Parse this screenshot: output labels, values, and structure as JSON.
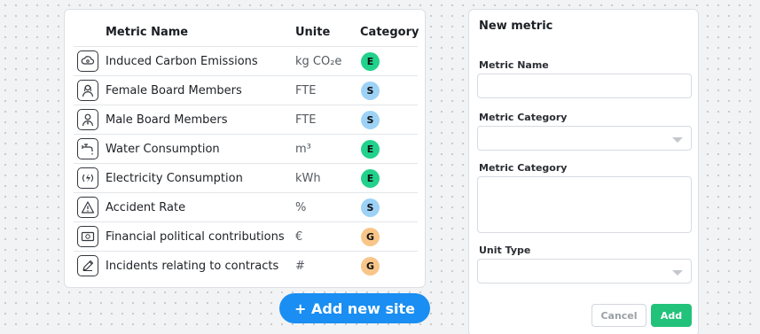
{
  "table": {
    "headers": {
      "name": "Metric Name",
      "unit": "Unite",
      "category": "Category"
    },
    "rows": [
      {
        "icon": "cloud-icon",
        "name": "Induced Carbon Emissions",
        "unit": "kg CO₂e",
        "category": "E"
      },
      {
        "icon": "woman-icon",
        "name": "Female Board Members",
        "unit": "FTE",
        "category": "S"
      },
      {
        "icon": "man-icon",
        "name": "Male Board Members",
        "unit": "FTE",
        "category": "S"
      },
      {
        "icon": "faucet-icon",
        "name": "Water Consumption",
        "unit": "m³",
        "category": "E"
      },
      {
        "icon": "electricity-icon",
        "name": "Electricity Consumption",
        "unit": "kWh",
        "category": "E"
      },
      {
        "icon": "warning-icon",
        "name": "Accident Rate",
        "unit": "%",
        "category": "S"
      },
      {
        "icon": "money-icon",
        "name": "Financial political contributions",
        "unit": "€",
        "category": "G"
      },
      {
        "icon": "pencil-icon",
        "name": "Incidents relating to contracts",
        "unit": "#",
        "category": "G"
      }
    ]
  },
  "category_colors": {
    "E": "#22d18b",
    "S": "#9dd2f6",
    "G": "#f8c689"
  },
  "add_site_label": "+ Add new site",
  "panel": {
    "title": "New metric",
    "name_label": "Metric Name",
    "category_label": "Metric Category",
    "category_label_2": "Metric Category",
    "unit_label": "Unit Type",
    "cancel_label": "Cancel",
    "add_label": "Add"
  },
  "colors": {
    "accent": "#1a8ef2",
    "add_button": "#22c27a"
  }
}
